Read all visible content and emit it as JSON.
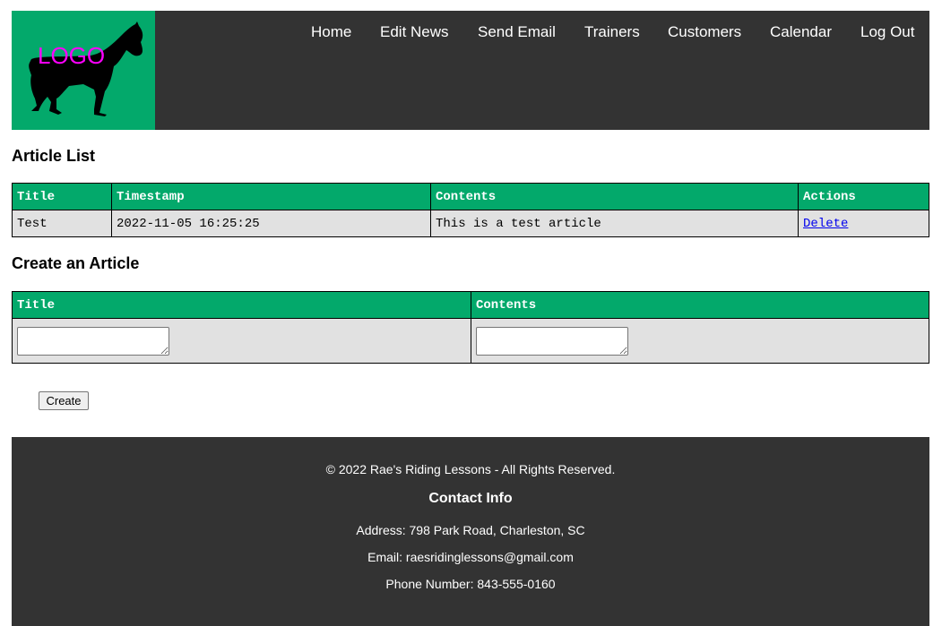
{
  "header": {
    "logo_text": "LOGO",
    "nav": [
      "Home",
      "Edit News",
      "Send Email",
      "Trainers",
      "Customers",
      "Calendar",
      "Log Out"
    ]
  },
  "article_list": {
    "title": "Article List",
    "columns": [
      "Title",
      "Timestamp",
      "Contents",
      "Actions"
    ],
    "rows": [
      {
        "title": "Test",
        "timestamp": "2022-11-05 16:25:25",
        "contents": "This is a test article",
        "action": "Delete"
      }
    ]
  },
  "create_article": {
    "title": "Create an Article",
    "columns": [
      "Title",
      "Contents"
    ],
    "title_value": "",
    "contents_value": "",
    "button": "Create"
  },
  "footer": {
    "copyright": "© 2022 Rae's Riding Lessons - All Rights Reserved.",
    "contact_title": "Contact Info",
    "address": "Address:  798 Park Road, Charleston, SC",
    "email": "Email:  raesridinglessons@gmail.com",
    "phone": "Phone Number:  843-555-0160"
  },
  "colors": {
    "accent": "#03a96b",
    "dark": "#333333",
    "logo_text": "#ff00ff"
  }
}
